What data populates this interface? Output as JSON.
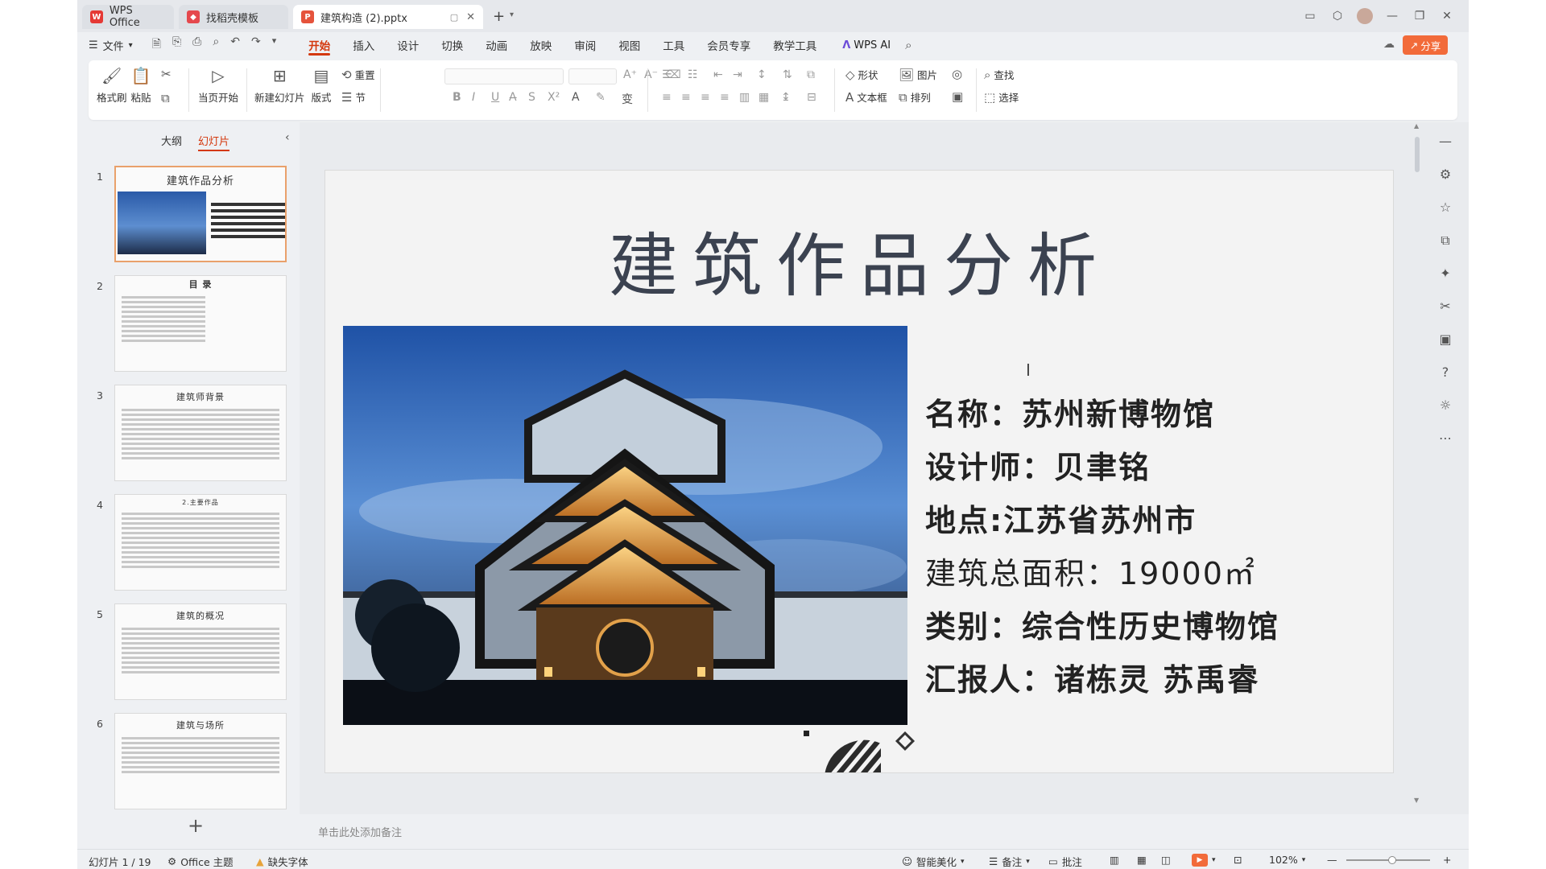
{
  "tabs": {
    "wps": "WPS Office",
    "template": "找稻壳模板",
    "document": "建筑构造 (2).pptx"
  },
  "menu": {
    "file": "文件",
    "items": [
      "开始",
      "插入",
      "设计",
      "切换",
      "动画",
      "放映",
      "审阅",
      "视图",
      "工具",
      "会员专享",
      "教学工具"
    ],
    "wps_ai": "WPS AI",
    "share": "分享"
  },
  "ribbon": {
    "format_painter": "格式刷",
    "paste": "粘贴",
    "play_from_current": "当页开始",
    "new_slide": "新建幻灯片",
    "layout": "版式",
    "reset": "重置",
    "section": "节",
    "shape": "形状",
    "picture": "图片",
    "textbox": "文本框",
    "arrange": "排列",
    "find": "查找",
    "select": "选择"
  },
  "left_panel": {
    "tab_outline": "大纲",
    "tab_slides": "幻灯片",
    "thumbnails": [
      {
        "num": "1",
        "title": "建筑作品分析"
      },
      {
        "num": "2",
        "title": "目 录"
      },
      {
        "num": "3",
        "title": "建筑师背景"
      },
      {
        "num": "4",
        "title": "2.主要作品"
      },
      {
        "num": "5",
        "title": "建筑的概况"
      },
      {
        "num": "6",
        "title": "建筑与场所"
      }
    ]
  },
  "slide": {
    "title": "建筑作品分析",
    "info": [
      "名称：苏州新博物馆",
      "设计师：贝聿铭",
      "地点:江苏省苏州市",
      "建筑总面积：19000㎡",
      "类别：综合性历史博物馆",
      "汇报人：诸栋灵 苏禹睿"
    ]
  },
  "notes_placeholder": "单击此处添加备注",
  "status": {
    "slide_count": "幻灯片 1 / 19",
    "theme": "Office 主题",
    "missing_font": "缺失字体",
    "beautify": "智能美化",
    "notes": "备注",
    "comments": "批注",
    "zoom": "102%"
  },
  "colors": {
    "accent": "#d4380d",
    "share": "#f26b3a"
  }
}
